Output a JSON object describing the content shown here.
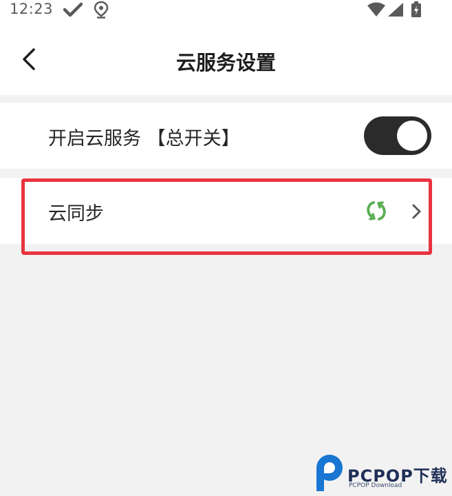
{
  "status_bar": {
    "time": "12:23"
  },
  "header": {
    "title": "云服务设置"
  },
  "settings": {
    "master_switch": {
      "label": "开启云服务 【总开关】",
      "enabled": true
    },
    "cloud_sync": {
      "label": "云同步"
    }
  },
  "colors": {
    "highlight": "#e8343f",
    "sync_icon": "#5caf57",
    "toggle_on": "#2b2b2b"
  },
  "watermark": {
    "brand": "PCPOP下载",
    "sub": "PCPOP Download"
  }
}
